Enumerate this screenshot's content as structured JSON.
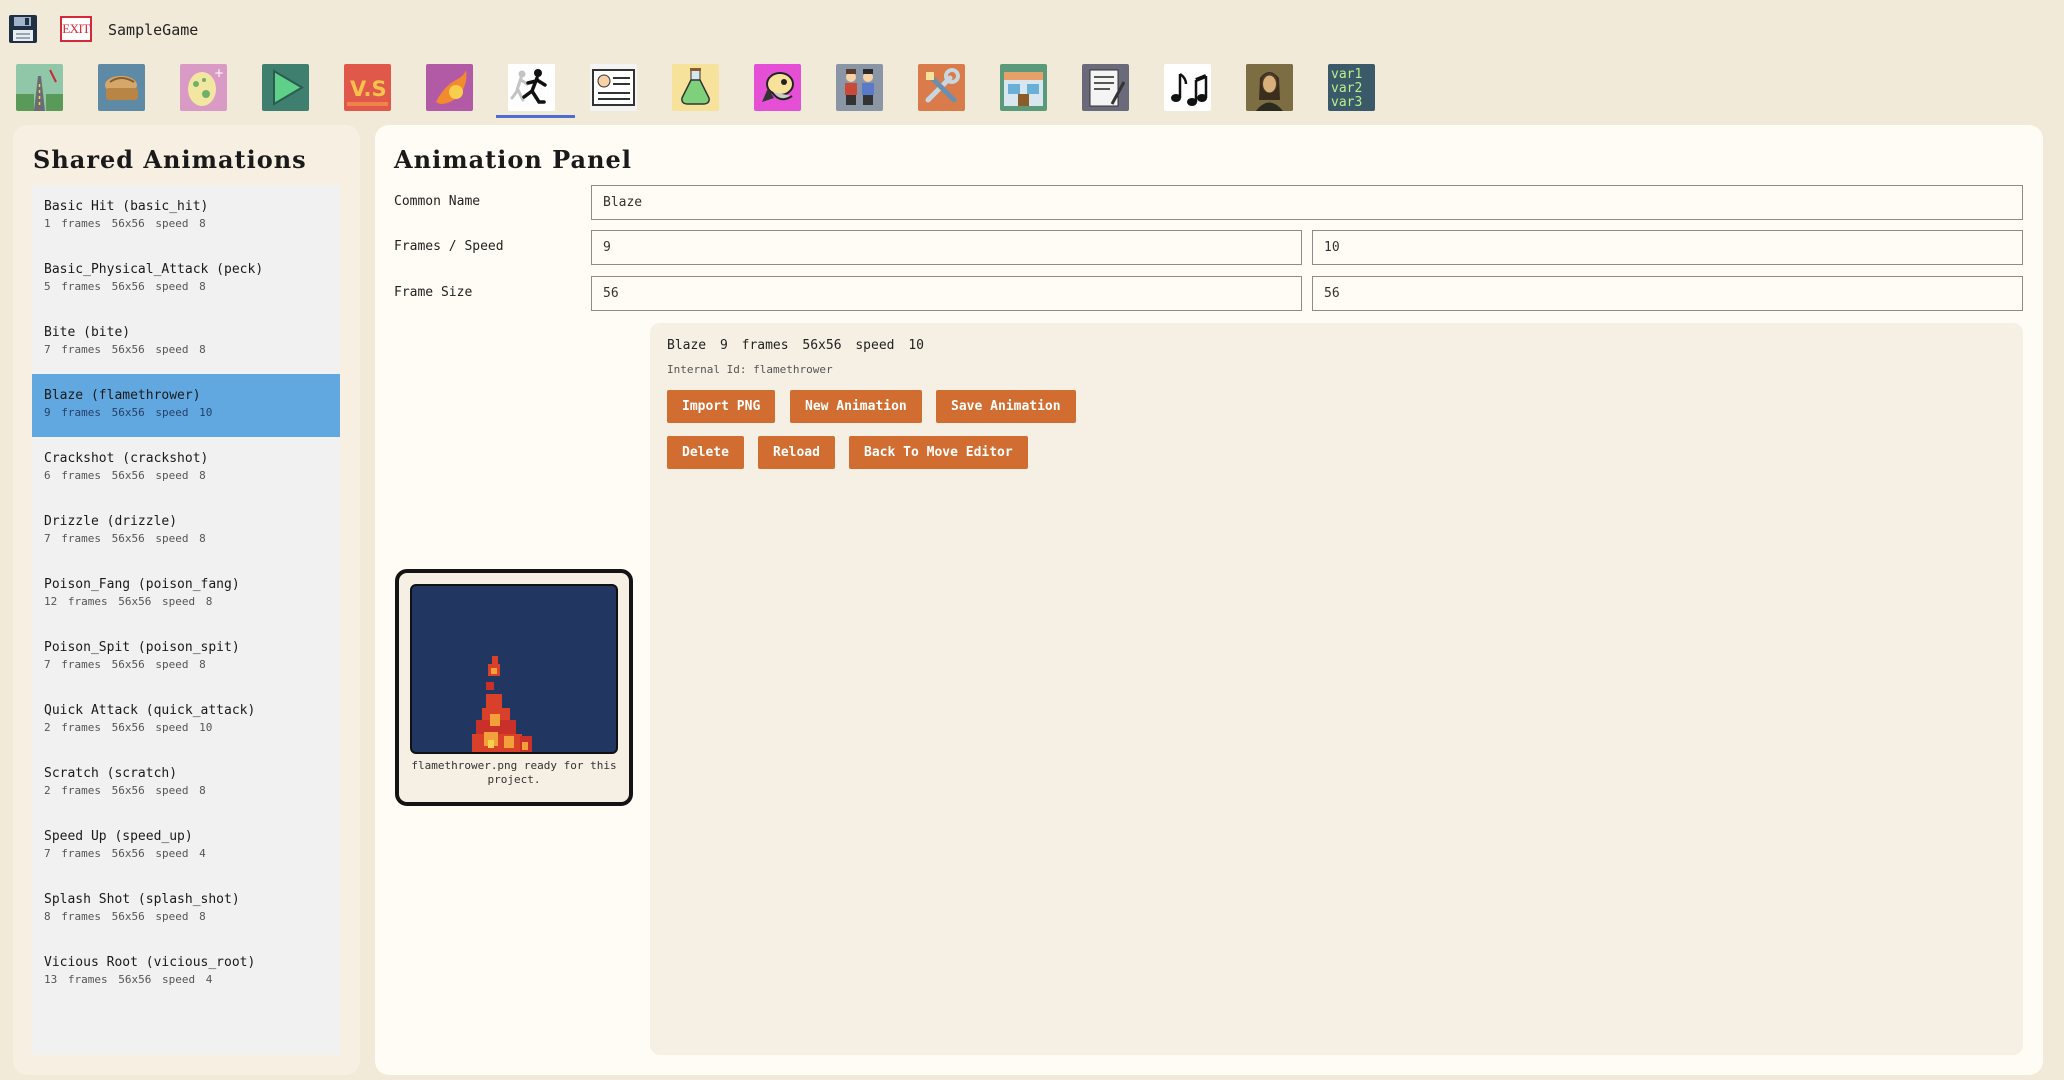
{
  "header": {
    "project_name": "SampleGame",
    "exit_label": "EXIT"
  },
  "toolbar": {
    "tools": [
      {
        "name": "map-tool",
        "icon": "road-icon"
      },
      {
        "name": "items-tool",
        "icon": "bread-icon"
      },
      {
        "name": "eggs-tool",
        "icon": "egg-icon"
      },
      {
        "name": "play-tool",
        "icon": "play-icon"
      },
      {
        "name": "battle-tool",
        "icon": "vs-icon"
      },
      {
        "name": "moves-tool",
        "icon": "fireball-icon"
      },
      {
        "name": "animations-tool",
        "icon": "running-figure-icon",
        "active": true
      },
      {
        "name": "dialogue-tool",
        "icon": "id-card-icon"
      },
      {
        "name": "potions-tool",
        "icon": "potion-icon"
      },
      {
        "name": "creature-tool",
        "icon": "monster-icon"
      },
      {
        "name": "trainers-tool",
        "icon": "trainers-icon"
      },
      {
        "name": "settings-tool",
        "icon": "tools-icon"
      },
      {
        "name": "shop-tool",
        "icon": "shop-icon"
      },
      {
        "name": "script-tool",
        "icon": "script-icon"
      },
      {
        "name": "music-tool",
        "icon": "music-notes-icon"
      },
      {
        "name": "art-tool",
        "icon": "portrait-icon"
      },
      {
        "name": "variables-tool",
        "icon": "variables-icon",
        "text": [
          "var1",
          "var2",
          "var3"
        ]
      }
    ]
  },
  "sidebar": {
    "title": "Shared Animations",
    "items": [
      {
        "label": "Basic Hit (basic_hit)",
        "meta": "1 frames 56x56 speed 8"
      },
      {
        "label": "Basic_Physical_Attack (peck)",
        "meta": "5 frames 56x56 speed 8"
      },
      {
        "label": "Bite (bite)",
        "meta": "7 frames 56x56 speed 8"
      },
      {
        "label": "Blaze (flamethrower)",
        "meta": "9 frames 56x56 speed 10",
        "selected": true
      },
      {
        "label": "Crackshot (crackshot)",
        "meta": "6 frames 56x56 speed 8"
      },
      {
        "label": "Drizzle (drizzle)",
        "meta": "7 frames 56x56 speed 8"
      },
      {
        "label": "Poison_Fang (poison_fang)",
        "meta": "12 frames 56x56 speed 8"
      },
      {
        "label": "Poison_Spit (poison_spit)",
        "meta": "7 frames 56x56 speed 8"
      },
      {
        "label": "Quick Attack (quick_attack)",
        "meta": "2 frames 56x56 speed 10"
      },
      {
        "label": "Scratch (scratch)",
        "meta": "2 frames 56x56 speed 8"
      },
      {
        "label": "Speed Up (speed_up)",
        "meta": "7 frames 56x56 speed 4"
      },
      {
        "label": "Splash Shot (splash_shot)",
        "meta": "8 frames 56x56 speed 8"
      },
      {
        "label": "Vicious Root (vicious_root)",
        "meta": "13 frames 56x56 speed 4"
      }
    ]
  },
  "panel": {
    "title": "Animation Panel",
    "common_name_label": "Common Name",
    "common_name_value": "Blaze",
    "frames_speed_label": "Frames / Speed",
    "frames_value": "9",
    "speed_value": "10",
    "frame_size_label": "Frame Size",
    "frame_width_value": "56",
    "frame_height_value": "56"
  },
  "editor": {
    "summary": "Blaze 9 frames 56x56 speed 10",
    "internal_id": "Internal Id: flamethrower",
    "buttons": {
      "import_png": "Import PNG",
      "new_animation": "New Animation",
      "save_animation": "Save Animation",
      "delete": "Delete",
      "reload": "Reload",
      "back_to_move_editor": "Back To Move Editor"
    }
  },
  "preview": {
    "caption": "flamethrower.png ready for this project.",
    "background_color": "#213661"
  },
  "colors": {
    "accent_button": "#d16d30",
    "selected_row": "#62a8e0",
    "page_background": "#f1ead9"
  }
}
